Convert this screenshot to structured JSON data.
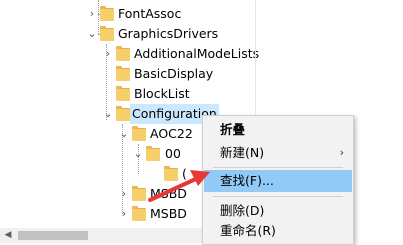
{
  "tree": {
    "items": [
      {
        "label": "FontAssoc"
      },
      {
        "label": "GraphicsDrivers"
      },
      {
        "label": "AdditionalModeLists"
      },
      {
        "label": "BasicDisplay"
      },
      {
        "label": "BlockList"
      },
      {
        "label": "Configuration"
      },
      {
        "label": "AOC22"
      },
      {
        "label": "00"
      },
      {
        "label": "("
      },
      {
        "label": "MSBD"
      },
      {
        "label": "MSBD"
      }
    ]
  },
  "context_menu": {
    "items": [
      {
        "label": "折叠"
      },
      {
        "label": "新建(N)",
        "submenu": "›"
      },
      {
        "label": "查找(F)..."
      },
      {
        "label": "删除(D)"
      },
      {
        "label": "重命名(R)"
      }
    ]
  },
  "colors": {
    "highlight": "#91c9f7",
    "selection": "#cce8ff",
    "arrow": "#e53935",
    "folder": "#f6cf6b"
  }
}
